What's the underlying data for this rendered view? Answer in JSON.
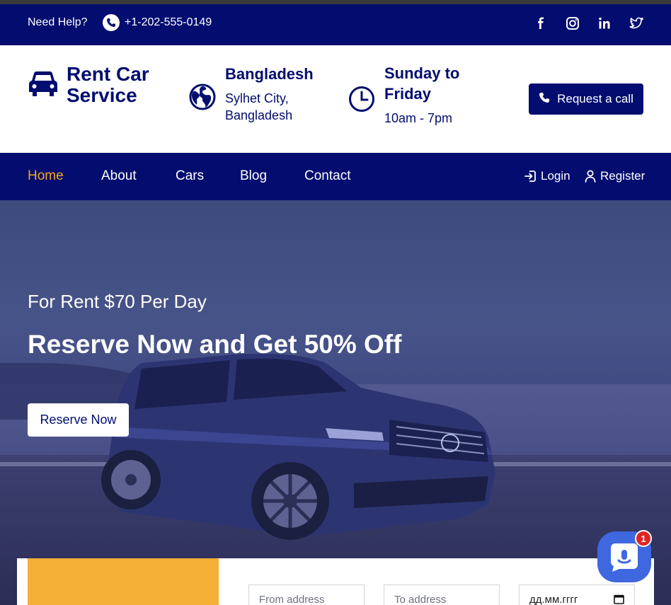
{
  "topbar": {
    "help_label": "Need Help?",
    "phone": "+1-202-555-0149",
    "social": [
      "facebook-icon",
      "instagram-icon",
      "linkedin-icon",
      "twitter-icon"
    ]
  },
  "header": {
    "brand": "Rent Car Service",
    "location_title": "Bangladesh",
    "location_sub": "Sylhet City, Bangladesh",
    "hours_title": "Sunday to Friday",
    "hours_sub": "10am - 7pm",
    "cta_label": "Request a call"
  },
  "nav": {
    "items": [
      {
        "label": "Home",
        "active": true
      },
      {
        "label": "About",
        "active": false
      },
      {
        "label": "Cars",
        "active": false
      },
      {
        "label": "Blog",
        "active": false
      },
      {
        "label": "Contact",
        "active": false
      }
    ],
    "login": "Login",
    "register": "Register"
  },
  "hero": {
    "price": "For Rent $70 Per Day",
    "headline": "Reserve Now and Get 50% Off",
    "button": "Reserve Now"
  },
  "booking": {
    "from_placeholder": "From address",
    "to_placeholder": "To address",
    "date_placeholder": "дд.мм.гггг"
  },
  "chat": {
    "badge_count": "1"
  },
  "colors": {
    "primary": "#020d6f",
    "accent": "#f5a623",
    "chat": "#3f67e0",
    "badge": "#e02424"
  }
}
